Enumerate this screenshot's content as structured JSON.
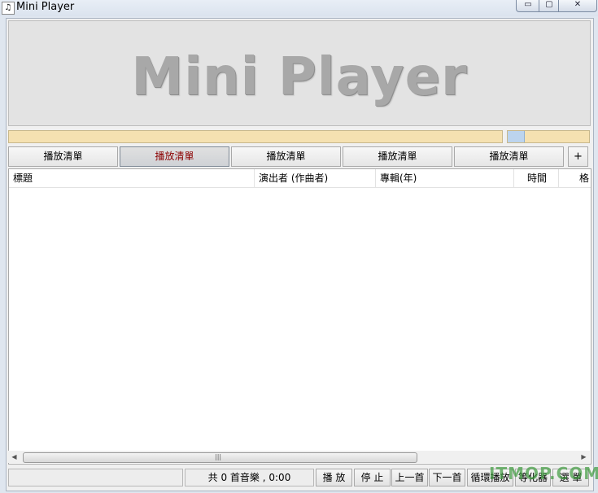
{
  "window": {
    "title": "Mini Player",
    "app_icon": "♫",
    "controls": {
      "minimize": "▭",
      "maximize": "▢",
      "close": "✕"
    }
  },
  "banner": {
    "title": "Mini Player"
  },
  "volume": {
    "level_percent": 20
  },
  "tabs": [
    {
      "label": "播放清單",
      "active": false
    },
    {
      "label": "播放清單",
      "active": true
    },
    {
      "label": "播放清單",
      "active": false
    },
    {
      "label": "播放清單",
      "active": false
    },
    {
      "label": "播放清單",
      "active": false
    }
  ],
  "tab_add_label": "+",
  "list": {
    "columns": [
      {
        "label": "標題"
      },
      {
        "label": "演出者 (作曲者)"
      },
      {
        "label": "專輯(年)"
      },
      {
        "label": "時間"
      },
      {
        "label": "格"
      }
    ],
    "scroll_left": "◀",
    "scroll_right": "▶",
    "scroll_grip": "|||"
  },
  "status": {
    "count_text": "共 0 首音樂 , 0:00"
  },
  "controls": {
    "play": "播 放",
    "stop": "停 止",
    "prev": "上一首",
    "next": "下一首",
    "loop": "循環播放",
    "equalizer": "等化器",
    "menu": "選 單"
  },
  "watermark": "ITMOP.COM",
  "colors": {
    "progress_fill": "#f5e1b1",
    "active_tab_text": "#8b0000",
    "volume_fill": "#bcd4ee"
  }
}
